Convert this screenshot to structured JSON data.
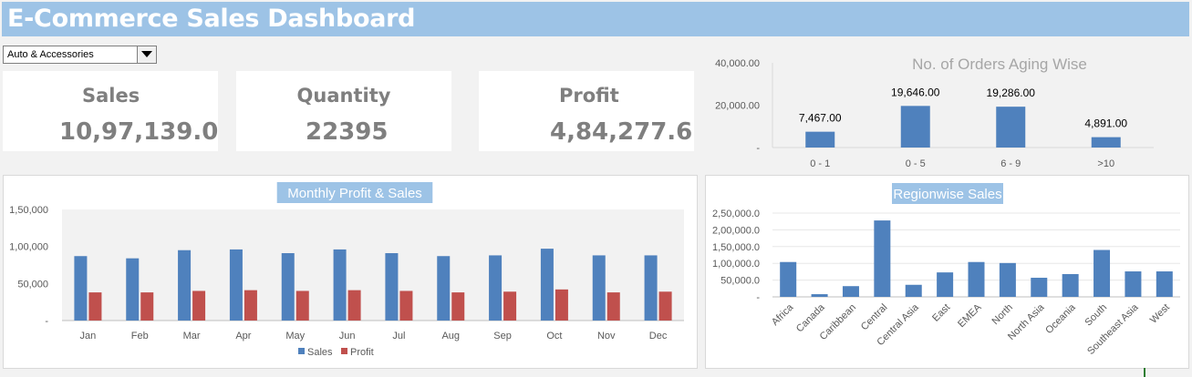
{
  "header": {
    "title": "E-Commerce Sales Dashboard"
  },
  "filter": {
    "selected": "Auto & Accessories"
  },
  "kpis": {
    "sales": {
      "label": "Sales",
      "value": "10,97,139.0"
    },
    "quantity": {
      "label": "Quantity",
      "value": "22395"
    },
    "profit": {
      "label": "Profit",
      "value": "4,84,277.6"
    }
  },
  "colors": {
    "header": "#9dc3e6",
    "sales": "#4f81bd",
    "profit": "#c0504d",
    "muted_text": "#7f7f7f"
  },
  "chart_data": [
    {
      "id": "aging",
      "type": "bar",
      "title": "No. of Orders Aging Wise",
      "categories": [
        "0 - 1",
        "0 - 5",
        "6 - 9",
        ">10"
      ],
      "values": [
        7467,
        19646,
        19286,
        4891
      ],
      "data_labels": [
        "7,467.00",
        "19,646.00",
        "19,286.00",
        "4,891.00"
      ],
      "ylim": [
        0,
        40000
      ],
      "yticks": [
        0,
        20000,
        40000
      ],
      "ytick_labels": [
        "-",
        "20,000.00",
        "40,000.00"
      ],
      "grid": false
    },
    {
      "id": "monthly",
      "type": "bar",
      "title": "Monthly Profit & Sales",
      "categories": [
        "Jan",
        "Feb",
        "Mar",
        "Apr",
        "May",
        "Jun",
        "Jul",
        "Aug",
        "Sep",
        "Oct",
        "Nov",
        "Dec"
      ],
      "series": [
        {
          "name": "Sales",
          "values": [
            87000,
            84000,
            95000,
            96000,
            91000,
            96000,
            91000,
            87000,
            88000,
            97000,
            88000,
            88000
          ]
        },
        {
          "name": "Profit",
          "values": [
            38000,
            38000,
            40000,
            41000,
            40000,
            41000,
            40000,
            38000,
            39000,
            42000,
            38000,
            39000
          ]
        }
      ],
      "ylim": [
        0,
        150000
      ],
      "yticks": [
        0,
        50000,
        100000,
        150000
      ],
      "ytick_labels": [
        "-",
        "50,000",
        "1,00,000",
        "1,50,000"
      ],
      "legend": "bottom",
      "grid": false
    },
    {
      "id": "region",
      "type": "bar",
      "title": "Regionwise Sales",
      "categories": [
        "Africa",
        "Canada",
        "Caribbean",
        "Central",
        "Central Asia",
        "East",
        "EMEA",
        "North",
        "North Asia",
        "Oceania",
        "South",
        "Southeast Asia",
        "West"
      ],
      "values": [
        104000,
        8000,
        32000,
        228000,
        36000,
        73000,
        104000,
        101000,
        57000,
        68000,
        140000,
        76000,
        76000
      ],
      "ylim": [
        0,
        250000
      ],
      "yticks": [
        0,
        50000,
        100000,
        150000,
        200000,
        250000
      ],
      "ytick_labels": [
        "-",
        "50,000.0",
        "1,00,000.0",
        "1,50,000.0",
        "2,00,000.0",
        "2,50,000.0"
      ],
      "grid": true
    }
  ]
}
